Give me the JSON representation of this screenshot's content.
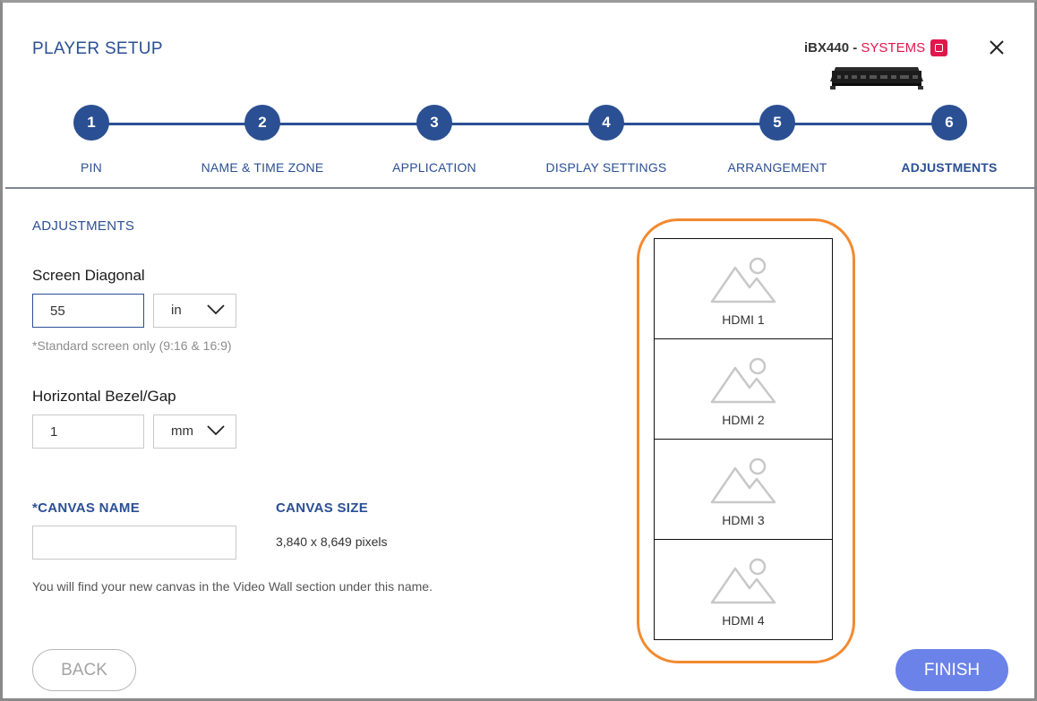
{
  "header": {
    "title": "PLAYER SETUP",
    "device_model": "iBX440",
    "device_separator": " - ",
    "device_os": "SYSTEMS"
  },
  "steps": [
    {
      "number": "1",
      "label": "PIN"
    },
    {
      "number": "2",
      "label": "NAME & TIME ZONE"
    },
    {
      "number": "3",
      "label": "APPLICATION"
    },
    {
      "number": "4",
      "label": "DISPLAY SETTINGS"
    },
    {
      "number": "5",
      "label": "ARRANGEMENT"
    },
    {
      "number": "6",
      "label": "ADJUSTMENTS"
    }
  ],
  "active_step": 6,
  "form": {
    "section_title": "ADJUSTMENTS",
    "screen_diagonal": {
      "label": "Screen Diagonal",
      "value": "55",
      "unit": "in",
      "hint": "*Standard screen only (9:16 & 16:9)"
    },
    "bezel": {
      "label": "Horizontal Bezel/Gap",
      "value": "1",
      "unit": "mm"
    },
    "canvas_name": {
      "label": "*CANVAS NAME",
      "value": "",
      "placeholder": ""
    },
    "canvas_size": {
      "label": "CANVAS SIZE",
      "value": "3,840 x 8,649 pixels"
    },
    "note": "You will find your new canvas in the Video Wall section under this name."
  },
  "preview": {
    "screens": [
      "HDMI 1",
      "HDMI 2",
      "HDMI 3",
      "HDMI 4"
    ]
  },
  "buttons": {
    "back": "BACK",
    "finish": "FINISH"
  },
  "colors": {
    "primary": "#2b4f93",
    "systems": "#e0174b",
    "finish_button": "#6b82e8",
    "highlight": "#f28a30"
  },
  "icons": {
    "close": "close-icon",
    "dropdown": "chevron-down-icon",
    "placeholder_image": "image-placeholder-icon",
    "systems_badge": "systems-icon"
  }
}
